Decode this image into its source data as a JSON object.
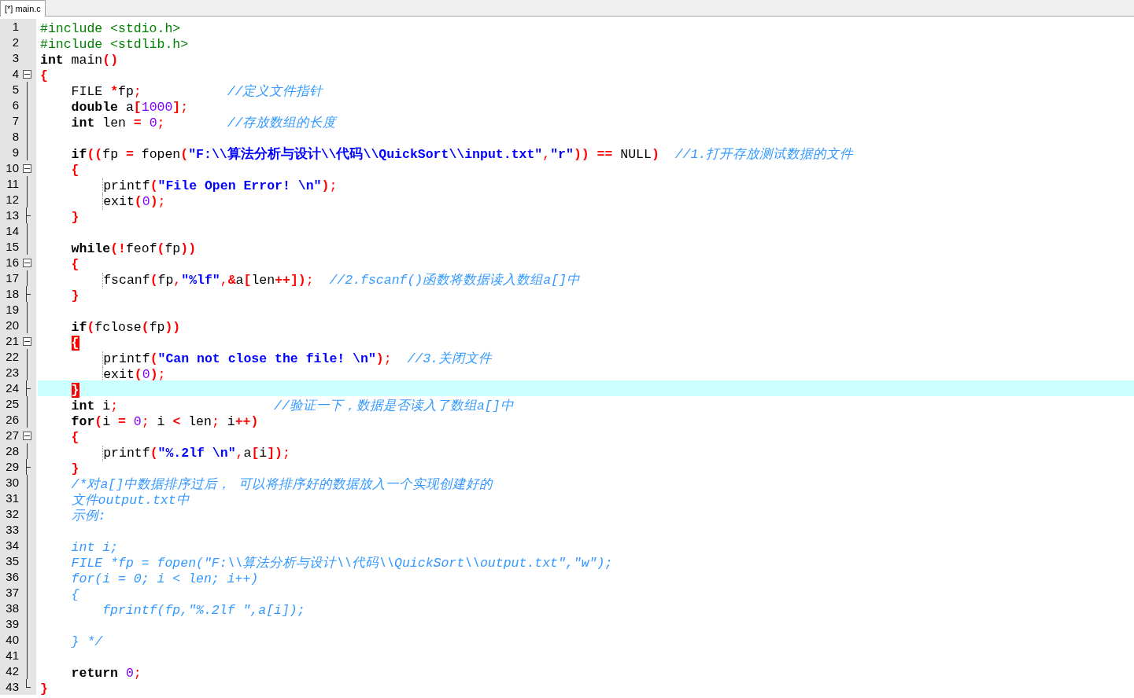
{
  "tabs": [
    {
      "label": "[*] main.c",
      "selected": true
    }
  ],
  "lines": [
    {
      "n": "1",
      "kind": "plain",
      "current": false,
      "guide": false,
      "tokens": [
        {
          "kind": "pp",
          "text": "#include <stdio.h>"
        }
      ]
    },
    {
      "n": "2",
      "kind": "plain",
      "current": false,
      "guide": false,
      "tokens": [
        {
          "kind": "pp",
          "text": "#include <stdlib.h>"
        }
      ]
    },
    {
      "n": "3",
      "kind": "plain",
      "current": false,
      "guide": false,
      "tokens": [
        {
          "kind": "kw",
          "text": "int"
        },
        {
          "kind": "id",
          "text": " main"
        },
        {
          "kind": "op",
          "text": "()"
        }
      ]
    },
    {
      "n": "4",
      "kind": "open",
      "current": false,
      "guide": false,
      "tokens": [
        {
          "kind": "op",
          "text": "{"
        }
      ]
    },
    {
      "n": "5",
      "kind": "body",
      "current": false,
      "guide": false,
      "tokens": [
        {
          "kind": "id",
          "text": "    FILE "
        },
        {
          "kind": "op",
          "text": "*"
        },
        {
          "kind": "id",
          "text": "fp"
        },
        {
          "kind": "p",
          "text": ";"
        },
        {
          "kind": "cmt",
          "text": "           //定义文件指针"
        }
      ]
    },
    {
      "n": "6",
      "kind": "body",
      "current": false,
      "guide": false,
      "tokens": [
        {
          "kind": "kw",
          "text": "    double"
        },
        {
          "kind": "id",
          "text": " a"
        },
        {
          "kind": "op",
          "text": "["
        },
        {
          "kind": "num",
          "text": "1000"
        },
        {
          "kind": "op",
          "text": "]"
        },
        {
          "kind": "p",
          "text": ";"
        }
      ]
    },
    {
      "n": "7",
      "kind": "body",
      "current": false,
      "guide": false,
      "tokens": [
        {
          "kind": "kw",
          "text": "    int"
        },
        {
          "kind": "id",
          "text": " len "
        },
        {
          "kind": "op",
          "text": "="
        },
        {
          "kind": "num",
          "text": " 0"
        },
        {
          "kind": "p",
          "text": ";"
        },
        {
          "kind": "cmt",
          "text": "        //存放数组的长度"
        }
      ]
    },
    {
      "n": "8",
      "kind": "body",
      "current": false
    },
    {
      "n": "9",
      "kind": "body",
      "current": false,
      "guide": false,
      "tokens": [
        {
          "kind": "kw",
          "text": "    if"
        },
        {
          "kind": "op",
          "text": "(("
        },
        {
          "kind": "id",
          "text": "fp "
        },
        {
          "kind": "op",
          "text": "="
        },
        {
          "kind": "id",
          "text": " fopen"
        },
        {
          "kind": "op",
          "text": "("
        },
        {
          "kind": "str",
          "text": "\"F:\\\\算法分析与设计\\\\代码\\\\QuickSort\\\\input.txt\""
        },
        {
          "kind": "p",
          "text": ","
        },
        {
          "kind": "str",
          "text": "\"r\""
        },
        {
          "kind": "op",
          "text": "))"
        },
        {
          "kind": "op",
          "text": " =="
        },
        {
          "kind": "id",
          "text": " NULL"
        },
        {
          "kind": "op",
          "text": ")"
        },
        {
          "kind": "cmt",
          "text": "  //1.打开存放测试数据的文件"
        }
      ]
    },
    {
      "n": "10",
      "kind": "open",
      "current": false,
      "guide": false,
      "tokens": [
        {
          "kind": "op",
          "text": "    {"
        }
      ]
    },
    {
      "n": "11",
      "kind": "body",
      "current": false,
      "guide": true,
      "tokens": [
        {
          "kind": "id",
          "text": "        printf"
        },
        {
          "kind": "op",
          "text": "("
        },
        {
          "kind": "str",
          "text": "\"File Open Error! \\n\""
        },
        {
          "kind": "op",
          "text": ")"
        },
        {
          "kind": "p",
          "text": ";"
        }
      ]
    },
    {
      "n": "12",
      "kind": "body",
      "current": false,
      "guide": true,
      "tokens": [
        {
          "kind": "id",
          "text": "        exit"
        },
        {
          "kind": "op",
          "text": "("
        },
        {
          "kind": "num",
          "text": "0"
        },
        {
          "kind": "op",
          "text": ")"
        },
        {
          "kind": "p",
          "text": ";"
        }
      ]
    },
    {
      "n": "13",
      "kind": "close",
      "current": false,
      "guide": false,
      "tokens": [
        {
          "kind": "op",
          "text": "    }"
        }
      ]
    },
    {
      "n": "14",
      "kind": "body",
      "current": false
    },
    {
      "n": "15",
      "kind": "body",
      "current": false,
      "guide": false,
      "tokens": [
        {
          "kind": "kw",
          "text": "    while"
        },
        {
          "kind": "op",
          "text": "(!"
        },
        {
          "kind": "id",
          "text": "feof"
        },
        {
          "kind": "op",
          "text": "("
        },
        {
          "kind": "id",
          "text": "fp"
        },
        {
          "kind": "op",
          "text": "))"
        }
      ]
    },
    {
      "n": "16",
      "kind": "open",
      "current": false,
      "guide": false,
      "tokens": [
        {
          "kind": "op",
          "text": "    {"
        }
      ]
    },
    {
      "n": "17",
      "kind": "body",
      "current": false,
      "guide": true,
      "tokens": [
        {
          "kind": "id",
          "text": "        fscanf"
        },
        {
          "kind": "op",
          "text": "("
        },
        {
          "kind": "id",
          "text": "fp"
        },
        {
          "kind": "p",
          "text": ","
        },
        {
          "kind": "str",
          "text": "\"%lf\""
        },
        {
          "kind": "p",
          "text": ","
        },
        {
          "kind": "op",
          "text": "&"
        },
        {
          "kind": "id",
          "text": "a"
        },
        {
          "kind": "op",
          "text": "["
        },
        {
          "kind": "id",
          "text": "len"
        },
        {
          "kind": "op",
          "text": "++])"
        },
        {
          "kind": "p",
          "text": ";"
        },
        {
          "kind": "cmt",
          "text": "  //2.fscanf()函数将数据读入数组a[]中"
        }
      ]
    },
    {
      "n": "18",
      "kind": "close",
      "current": false,
      "guide": false,
      "tokens": [
        {
          "kind": "op",
          "text": "    }"
        }
      ]
    },
    {
      "n": "19",
      "kind": "body",
      "current": false
    },
    {
      "n": "20",
      "kind": "body",
      "current": false,
      "guide": false,
      "tokens": [
        {
          "kind": "kw",
          "text": "    if"
        },
        {
          "kind": "op",
          "text": "("
        },
        {
          "kind": "id",
          "text": "fclose"
        },
        {
          "kind": "op",
          "text": "("
        },
        {
          "kind": "id",
          "text": "fp"
        },
        {
          "kind": "op",
          "text": "))"
        }
      ]
    },
    {
      "n": "21",
      "kind": "open",
      "current": false,
      "guide": false,
      "tokens": [
        {
          "kind": "match",
          "text": "    {"
        }
      ]
    },
    {
      "n": "22",
      "kind": "body",
      "current": false,
      "guide": true,
      "tokens": [
        {
          "kind": "id",
          "text": "        printf"
        },
        {
          "kind": "op",
          "text": "("
        },
        {
          "kind": "str",
          "text": "\"Can not close the file! \\n\""
        },
        {
          "kind": "op",
          "text": ")"
        },
        {
          "kind": "p",
          "text": ";"
        },
        {
          "kind": "cmt",
          "text": "  //3.关闭文件"
        }
      ]
    },
    {
      "n": "23",
      "kind": "body",
      "current": false,
      "guide": true,
      "tokens": [
        {
          "kind": "id",
          "text": "        exit"
        },
        {
          "kind": "op",
          "text": "("
        },
        {
          "kind": "num",
          "text": "0"
        },
        {
          "kind": "op",
          "text": ")"
        },
        {
          "kind": "p",
          "text": ";"
        }
      ]
    },
    {
      "n": "24",
      "kind": "close",
      "current": true,
      "guide": false,
      "tokens": [
        {
          "kind": "match",
          "text": "    }"
        }
      ]
    },
    {
      "n": "25",
      "kind": "body",
      "current": false,
      "guide": false,
      "tokens": [
        {
          "kind": "kw",
          "text": "    int"
        },
        {
          "kind": "id",
          "text": " i"
        },
        {
          "kind": "p",
          "text": ";"
        },
        {
          "kind": "cmt",
          "text": "                    //验证一下，数据是否读入了数组a[]中"
        }
      ]
    },
    {
      "n": "26",
      "kind": "body",
      "current": false,
      "guide": false,
      "tokens": [
        {
          "kind": "kw",
          "text": "    for"
        },
        {
          "kind": "op",
          "text": "("
        },
        {
          "kind": "id",
          "text": "i "
        },
        {
          "kind": "op",
          "text": "="
        },
        {
          "kind": "num",
          "text": " 0"
        },
        {
          "kind": "p",
          "text": ";"
        },
        {
          "kind": "id",
          "text": " i "
        },
        {
          "kind": "op",
          "text": "<"
        },
        {
          "kind": "id",
          "text": " len"
        },
        {
          "kind": "p",
          "text": ";"
        },
        {
          "kind": "id",
          "text": " i"
        },
        {
          "kind": "op",
          "text": "++)"
        }
      ]
    },
    {
      "n": "27",
      "kind": "open",
      "current": false,
      "guide": false,
      "tokens": [
        {
          "kind": "op",
          "text": "    {"
        }
      ]
    },
    {
      "n": "28",
      "kind": "body",
      "current": false,
      "guide": true,
      "tokens": [
        {
          "kind": "id",
          "text": "        printf"
        },
        {
          "kind": "op",
          "text": "("
        },
        {
          "kind": "str",
          "text": "\"%.2lf \\n\""
        },
        {
          "kind": "p",
          "text": ","
        },
        {
          "kind": "id",
          "text": "a"
        },
        {
          "kind": "op",
          "text": "["
        },
        {
          "kind": "id",
          "text": "i"
        },
        {
          "kind": "op",
          "text": "])"
        },
        {
          "kind": "p",
          "text": ";"
        }
      ]
    },
    {
      "n": "29",
      "kind": "close",
      "current": false,
      "guide": false,
      "tokens": [
        {
          "kind": "op",
          "text": "    }"
        }
      ]
    },
    {
      "n": "30",
      "kind": "body",
      "current": false,
      "guide": false,
      "tokens": [
        {
          "kind": "cmt",
          "text": "    /*对a[]中数据排序过后， 可以将排序好的数据放入一个实现创建好的"
        }
      ]
    },
    {
      "n": "31",
      "kind": "body",
      "current": false,
      "guide": false,
      "tokens": [
        {
          "kind": "cmt",
          "text": "    文件output.txt中"
        }
      ]
    },
    {
      "n": "32",
      "kind": "body",
      "current": false,
      "guide": false,
      "tokens": [
        {
          "kind": "cmt",
          "text": "    示例:"
        }
      ]
    },
    {
      "n": "33",
      "kind": "body",
      "current": false
    },
    {
      "n": "34",
      "kind": "body",
      "current": false,
      "guide": false,
      "tokens": [
        {
          "kind": "cmt",
          "text": "    int i;"
        }
      ]
    },
    {
      "n": "35",
      "kind": "body",
      "current": false,
      "guide": false,
      "tokens": [
        {
          "kind": "cmt",
          "text": "    FILE *fp = fopen(\"F:\\\\算法分析与设计\\\\代码\\\\QuickSort\\\\output.txt\",\"w\");"
        }
      ]
    },
    {
      "n": "36",
      "kind": "body",
      "current": false,
      "guide": false,
      "tokens": [
        {
          "kind": "cmt",
          "text": "    for(i = 0; i < len; i++)"
        }
      ]
    },
    {
      "n": "37",
      "kind": "body",
      "current": false,
      "guide": false,
      "tokens": [
        {
          "kind": "cmt",
          "text": "    {"
        }
      ]
    },
    {
      "n": "38",
      "kind": "body",
      "current": false,
      "guide": false,
      "tokens": [
        {
          "kind": "cmt",
          "text": "        fprintf(fp,\"%.2lf \",a[i]);"
        }
      ]
    },
    {
      "n": "39",
      "kind": "body",
      "current": false
    },
    {
      "n": "40",
      "kind": "body",
      "current": false,
      "guide": false,
      "tokens": [
        {
          "kind": "cmt",
          "text": "    } */"
        }
      ]
    },
    {
      "n": "41",
      "kind": "body",
      "current": false
    },
    {
      "n": "42",
      "kind": "body",
      "current": false,
      "guide": false,
      "tokens": [
        {
          "kind": "kw",
          "text": "    return"
        },
        {
          "kind": "num",
          "text": " 0"
        },
        {
          "kind": "p",
          "text": ";"
        }
      ]
    },
    {
      "n": "43",
      "kind": "last",
      "current": false,
      "guide": false,
      "tokens": [
        {
          "kind": "op",
          "text": "}"
        }
      ]
    }
  ]
}
